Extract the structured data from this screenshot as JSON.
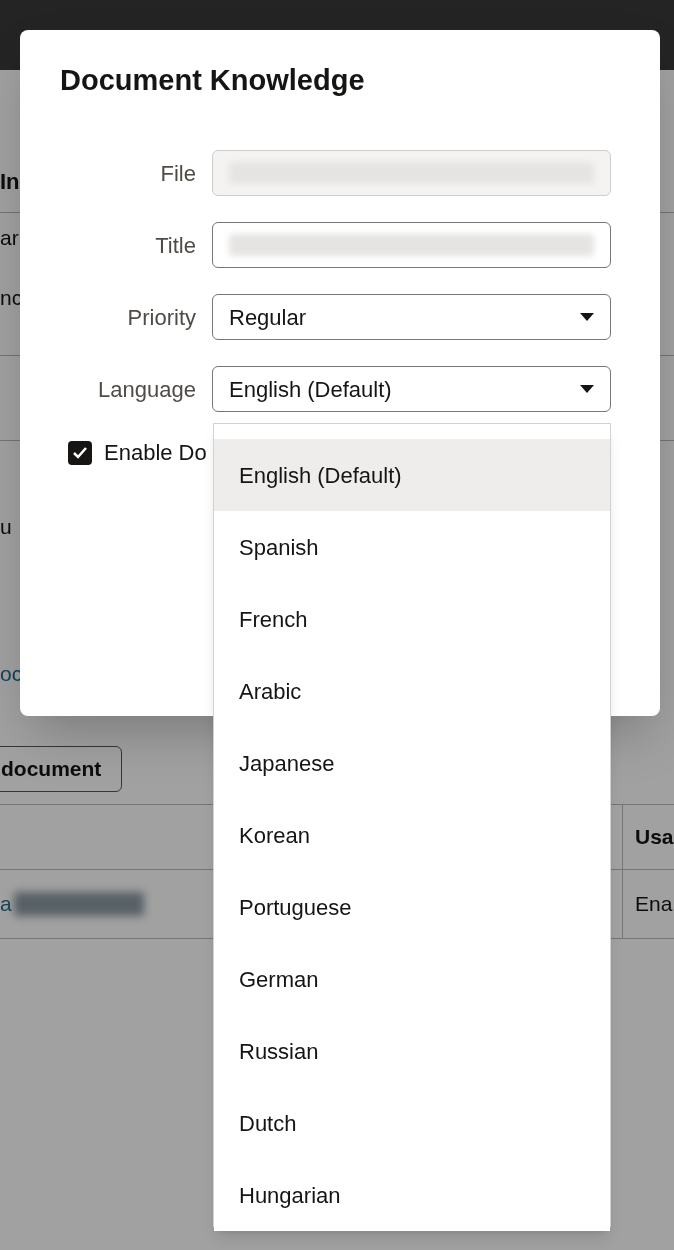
{
  "background": {
    "heading": "In",
    "row_lines": [
      {
        "left": "ar"
      }
    ],
    "row_extra_left": "nc",
    "note_left": "u",
    "link": "oc",
    "button": "document",
    "table": {
      "column_header": "Usa",
      "row_link": "a",
      "row_cell": "Ena"
    }
  },
  "dialog": {
    "title": "Document Knowledge",
    "fields": [
      {
        "label": "File",
        "kind": "text",
        "disabled": true
      },
      {
        "label": "Title",
        "kind": "text",
        "disabled": false
      },
      {
        "label": "Priority",
        "kind": "select",
        "disabled": false,
        "value": "Regular"
      },
      {
        "label": "Language",
        "kind": "select",
        "disabled": false,
        "value": "English (Default)",
        "expanded": true
      }
    ],
    "checkbox": {
      "label": "Enable Do",
      "checked": true
    }
  },
  "language_menu": [
    {
      "label": "English (Default)",
      "selected": true
    },
    {
      "label": "Spanish",
      "selected": false
    },
    {
      "label": "French",
      "selected": false
    },
    {
      "label": "Arabic",
      "selected": false
    },
    {
      "label": "Japanese",
      "selected": false
    },
    {
      "label": "Korean",
      "selected": false
    },
    {
      "label": "Portuguese",
      "selected": false
    },
    {
      "label": "German",
      "selected": false
    },
    {
      "label": "Russian",
      "selected": false
    },
    {
      "label": "Dutch",
      "selected": false
    },
    {
      "label": "Hungarian",
      "selected": false
    }
  ]
}
